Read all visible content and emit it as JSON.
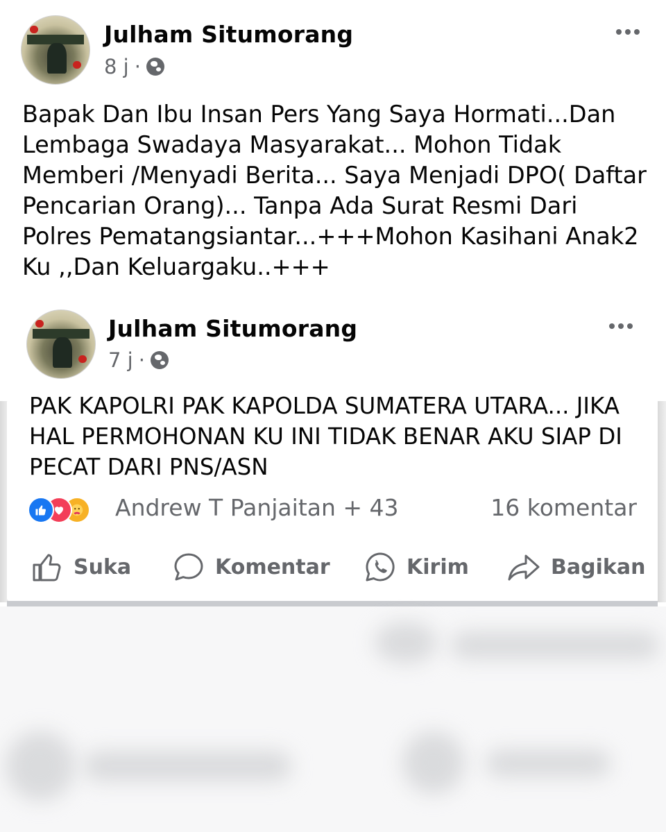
{
  "post": {
    "author": "Julham Situmorang",
    "time": "8 j",
    "separator": "·",
    "privacy_icon": "globe-icon",
    "menu_icon": "more-options-icon",
    "text": "Bapak Dan Ibu Insan Pers Yang Saya Hormati...Dan Lembaga Swadaya Masyarakat... Mohon Tidak Memberi /Menyadi Berita... Saya Menjadi DPO( Daftar Pencarian Orang)... Tanpa Ada Surat Resmi Dari Polres Pematangsiantar...+++Mohon Kasihani Anak2 Ku ,,Dan Keluargaku..+++"
  },
  "shared_post": {
    "author": "Julham Situmorang",
    "time": "7 j",
    "separator": "·",
    "privacy_icon": "globe-icon",
    "menu_icon": "more-options-icon",
    "text": "PAK KAPOLRI PAK KAPOLDA SUMATERA UTARA... JIKA HAL PERMOHONAN KU INI TIDAK BENAR AKU SIAP DI PECAT DARI PNS/ASN"
  },
  "engagement": {
    "reaction_icons": [
      "like-reaction-icon",
      "love-reaction-icon",
      "care-reaction-icon"
    ],
    "reactors": "Andrew T Panjaitan + 43",
    "comments": "16 komentar"
  },
  "actions": {
    "like": "Suka",
    "comment": "Komentar",
    "send": "Kirim",
    "share": "Bagikan"
  },
  "colors": {
    "text_primary": "#050505",
    "text_secondary": "#65676b",
    "like_blue": "#1877f2",
    "love_red": "#f33e58",
    "care_yellow": "#f7b125"
  }
}
